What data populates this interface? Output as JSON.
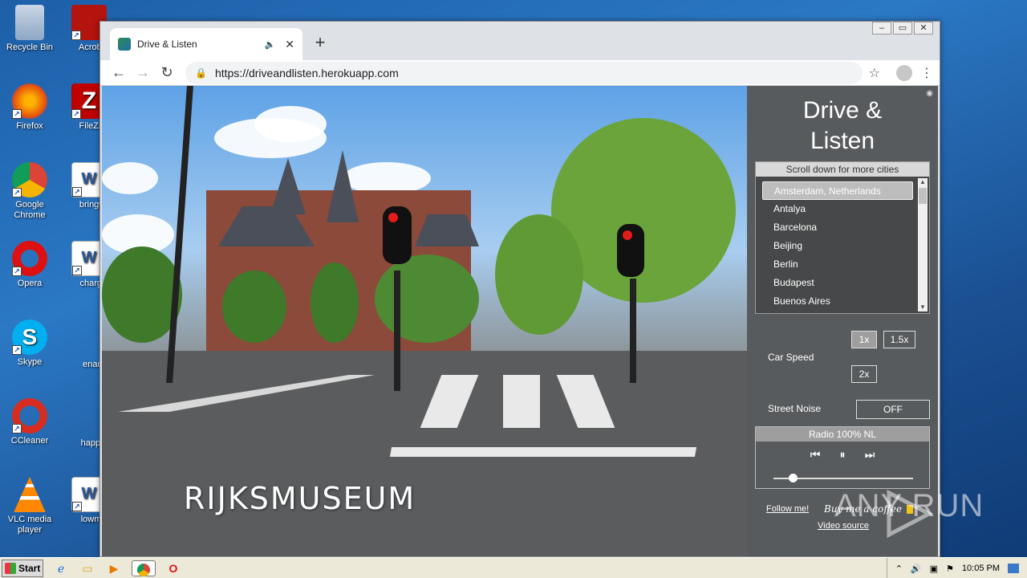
{
  "desktop": {
    "icons": [
      {
        "label": "Recycle Bin",
        "icon": "recycle-bin-icon"
      },
      {
        "label": "Acrobat Reader",
        "icon": "acrobat-icon"
      },
      {
        "label": "Firefox",
        "icon": "firefox-icon"
      },
      {
        "label": "FileZilla C",
        "icon": "filezilla-icon"
      },
      {
        "label": "Google Chrome",
        "icon": "chrome-icon"
      },
      {
        "label": "bringwww",
        "icon": "word-doc-icon"
      },
      {
        "label": "Opera",
        "icon": "opera-icon"
      },
      {
        "label": "chargeciv",
        "icon": "word-doc-icon"
      },
      {
        "label": "Skype",
        "icon": "skype-icon"
      },
      {
        "label": "enadd.p",
        "icon": "file-icon"
      },
      {
        "label": "CCleaner",
        "icon": "ccleaner-icon"
      },
      {
        "label": "happylea",
        "icon": "file-icon"
      },
      {
        "label": "VLC media player",
        "icon": "vlc-icon"
      },
      {
        "label": "lowmatur",
        "icon": "word-doc-icon"
      }
    ]
  },
  "browser": {
    "tab_title": "Drive & Listen",
    "new_tab": "+",
    "url": "https://driveandlisten.herokuapp.com",
    "window_controls": [
      "‒",
      "▭",
      "✕"
    ]
  },
  "video": {
    "caption": "RIJKSMUSEUM"
  },
  "panel": {
    "title_line1": "Drive &",
    "title_line2": "Listen",
    "city_header": "Scroll down for more cities",
    "cities": [
      "Amsterdam, Netherlands",
      "Antalya",
      "Barcelona",
      "Beijing",
      "Berlin",
      "Budapest",
      "Buenos Aires"
    ],
    "selected_city": "Amsterdam, Netherlands",
    "speed_options": [
      "1x",
      "1.5x",
      "2x"
    ],
    "selected_speed": "1x",
    "car_speed_label": "Car Speed",
    "street_noise_label": "Street Noise",
    "street_noise_value": "OFF",
    "radio_station": "Radio 100% NL",
    "volume_fraction": 0.14,
    "follow_link": "Follow me!",
    "coffee_link": "Buy me a coffee",
    "video_source_link": "Video source"
  },
  "watermark": "ANY RUN",
  "taskbar": {
    "start_label": "Start",
    "clock": "10:05 PM"
  }
}
